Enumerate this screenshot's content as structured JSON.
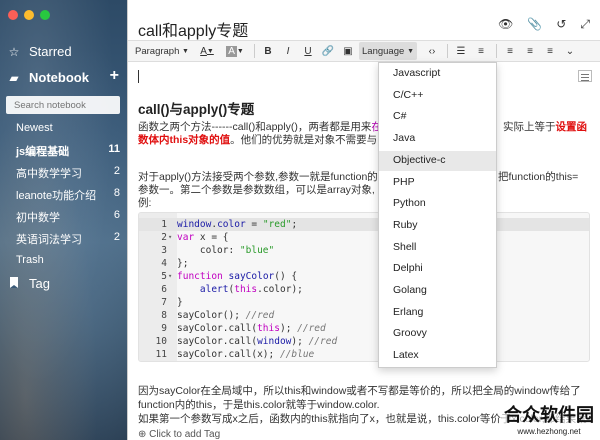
{
  "window": {
    "title": "call和apply专题"
  },
  "sidebar": {
    "starred": "Starred",
    "notebook": "Notebook",
    "add": "+",
    "search_placeholder": "Search notebook",
    "items": [
      {
        "label": "Newest",
        "count": ""
      },
      {
        "label": "js编程基础",
        "count": "11"
      },
      {
        "label": "高中数学学习",
        "count": "2"
      },
      {
        "label": "leanote功能介绍",
        "count": "8"
      },
      {
        "label": "初中数学",
        "count": "6"
      },
      {
        "label": "英语词法学习",
        "count": "2"
      },
      {
        "label": "Trash",
        "count": ""
      }
    ],
    "tag": "Tag"
  },
  "toolbar": {
    "paragraph": "Paragraph",
    "language": "Language"
  },
  "doc": {
    "heading": "call()与apply()专题",
    "p1a": "函数之两个方法------call()和apply()，两者都是用来",
    "p1b": "在",
    "p1c": "实际上等于",
    "p1d": "设置函",
    "p2a": "数体内this对象的值",
    "p2b": "。他们的优势就是对象不需要与",
    "p3a": "对于apply()方法接受两个参数,参数一就是function的",
    "p3b": "把function的this=",
    "p4": "参数一。第二个参数是参数数组，可以是array对象,",
    "p5": "例:",
    "after1": "因为sayColor在全局域中，所以this和window或者不写都是等价的，所以把全局的window传给了",
    "after2": "function内的this，于是this.color就等于window.color.",
    "after3": "如果第一个参数写成x之后，函数内的this就指向了x，也就是说，this.color等价于x.color,那结果就",
    "add_tag": "Click to add Tag"
  },
  "code": [
    {
      "n": "1",
      "fold": "",
      "parts": [
        [
          "fn",
          "window"
        ],
        [
          "",
          "."
        ],
        [
          "fn",
          "color"
        ],
        [
          "",
          " = "
        ],
        [
          "str",
          "\"red\""
        ],
        [
          "",
          ";"
        ]
      ]
    },
    {
      "n": "2",
      "fold": "▾",
      "parts": [
        [
          "kw",
          "var"
        ],
        [
          "",
          " x = {"
        ]
      ]
    },
    {
      "n": "3",
      "fold": "",
      "parts": [
        [
          "",
          "    color: "
        ],
        [
          "str",
          "\"blue\""
        ]
      ]
    },
    {
      "n": "4",
      "fold": "",
      "parts": [
        [
          "",
          "};"
        ]
      ]
    },
    {
      "n": "5",
      "fold": "▾",
      "parts": [
        [
          "kw",
          "function"
        ],
        [
          "",
          " "
        ],
        [
          "fn",
          "sayColor"
        ],
        [
          "",
          "() {"
        ]
      ]
    },
    {
      "n": "6",
      "fold": "",
      "parts": [
        [
          "",
          "    "
        ],
        [
          "fn",
          "alert"
        ],
        [
          "",
          "("
        ],
        [
          "kw",
          "this"
        ],
        [
          "",
          ".color);"
        ]
      ]
    },
    {
      "n": "7",
      "fold": "",
      "parts": [
        [
          "",
          "}"
        ]
      ]
    },
    {
      "n": "8",
      "fold": "",
      "parts": [
        [
          "",
          "sayColor(); "
        ],
        [
          "cm",
          "//red"
        ]
      ]
    },
    {
      "n": "9",
      "fold": "",
      "parts": [
        [
          "",
          "sayColor.call("
        ],
        [
          "kw",
          "this"
        ],
        [
          "",
          "); "
        ],
        [
          "cm",
          "//red"
        ]
      ]
    },
    {
      "n": "10",
      "fold": "",
      "parts": [
        [
          "",
          "sayColor.call("
        ],
        [
          "fn",
          "window"
        ],
        [
          "",
          "); "
        ],
        [
          "cm",
          "//red"
        ]
      ]
    },
    {
      "n": "11",
      "fold": "",
      "parts": [
        [
          "",
          "sayColor.call(x); "
        ],
        [
          "cm",
          "//blue"
        ]
      ]
    }
  ],
  "languages": [
    "Javascript",
    "C/C++",
    "C#",
    "Java",
    "Objective-c",
    "PHP",
    "Python",
    "Ruby",
    "Shell",
    "Delphi",
    "Golang",
    "Erlang",
    "Groovy",
    "Latex"
  ],
  "highlighted_language": "Objective-c",
  "watermark": {
    "main": "合众软件园",
    "sub": "www.hezhong.net"
  }
}
